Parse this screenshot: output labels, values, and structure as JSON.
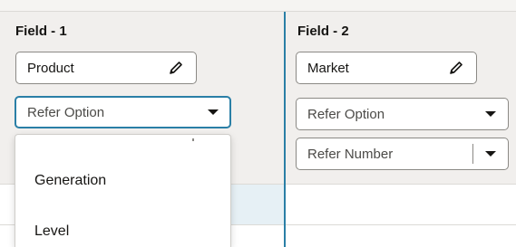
{
  "field1": {
    "header": "Field - 1",
    "value": "Product",
    "dropdown_value": "Refer Option",
    "menu_items": [
      "Generation",
      "Level"
    ]
  },
  "field2": {
    "header": "Field - 2",
    "value": "Market",
    "dropdown_value": "Refer Option",
    "number_select_value": "Refer Number"
  },
  "colors": {
    "focus_accent": "#2a7fa6",
    "column_background": "#f1efed",
    "row_highlight": "#e6f0f5"
  },
  "icons": [
    "pencil-icon",
    "chevron-down-icon"
  ]
}
